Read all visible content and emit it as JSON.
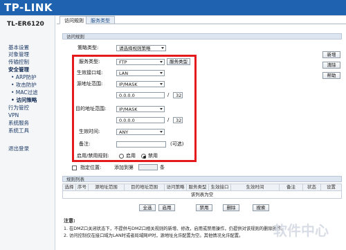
{
  "header": {
    "brand": "TP-LINK"
  },
  "sidebar": {
    "model": "TL-ER6120",
    "items": [
      {
        "label": "基本设置"
      },
      {
        "label": "对象管理"
      },
      {
        "label": "传输控制"
      },
      {
        "label": "安全管理"
      },
      {
        "label": "• ARP防护"
      },
      {
        "label": "• 攻击防护"
      },
      {
        "label": "• MAC过滤"
      },
      {
        "label": "• 访问策略"
      },
      {
        "label": "行为管控"
      },
      {
        "label": "VPN"
      },
      {
        "label": "系统服务"
      },
      {
        "label": "系统工具"
      },
      {
        "label": "退出登录"
      }
    ]
  },
  "tabs": [
    {
      "label": "访问规则"
    },
    {
      "label": "服务类型"
    }
  ],
  "rules": {
    "section_title": "访问规则",
    "policy_type_label": "策略类型:",
    "policy_type_value": "请选择规则策略",
    "service_type_label": "服务类型:",
    "service_type_value": "FTP",
    "service_type_button": "服务类型",
    "iface_label": "生效接口域:",
    "iface_value": "LAN",
    "src_label": "源地址范围:",
    "src_mode": "IP/MASK",
    "src_ip": "0.0.0.0",
    "src_mask": "32",
    "dst_label": "目的地址范围:",
    "dst_mode": "IP/MASK",
    "dst_ip": "0.0.0.0",
    "dst_mask": "32",
    "slash": "/",
    "time_label": "生效时间:",
    "time_value": "ANY",
    "remark_label": "备注:",
    "remark_value": "",
    "remark_hint": "(可选)",
    "state_label": "启用/禁用规则:",
    "enable_label": "启用",
    "disable_label": "禁用",
    "position_label": "指定位置:",
    "position_text": "添加到第",
    "position_value": "",
    "position_unit": "条"
  },
  "side_buttons": {
    "new": "新增",
    "clear": "清除",
    "help": "帮助"
  },
  "list": {
    "section_title": "规则列表",
    "columns": [
      "选择",
      "序号",
      "源地址范围",
      "目的地址范围",
      "访问策略",
      "服务类型",
      "生效接口",
      "生效时间",
      "备注",
      "状态",
      "设置"
    ],
    "empty_text": "该列表为空",
    "buttons": [
      "全选",
      "启用",
      "禁用",
      "删除",
      "搜索"
    ]
  },
  "notes": {
    "title": "注意:",
    "line1": "1. 在DMZ口关闭状态下，不提供与DMZ口相关规则的新增、修改，启用或禁用操作，仍提供对该规则的删除操作。",
    "line2": "2. 访问控制仅在接口域为LAN时或者局域网IP时，源地址允许配置为空。其他情况允许配置。"
  },
  "watermark": {
    "text": "软件中心"
  }
}
